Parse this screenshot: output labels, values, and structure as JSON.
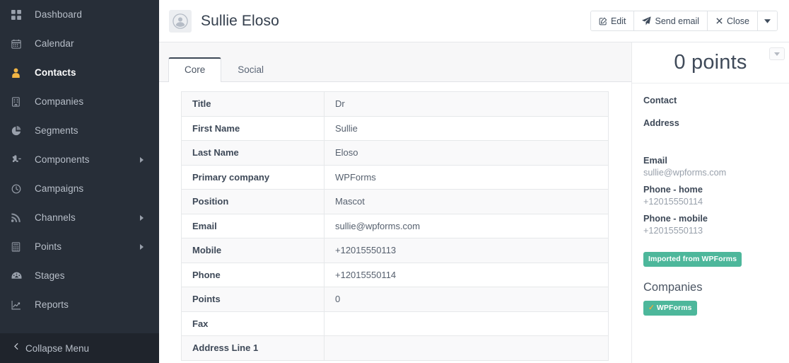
{
  "sidebar": {
    "items": [
      {
        "label": "Dashboard",
        "icon": "dashboard-icon",
        "active": false,
        "submenu": false
      },
      {
        "label": "Calendar",
        "icon": "calendar-icon",
        "active": false,
        "submenu": false
      },
      {
        "label": "Contacts",
        "icon": "contact-icon",
        "active": true,
        "submenu": false
      },
      {
        "label": "Companies",
        "icon": "building-icon",
        "active": false,
        "submenu": false
      },
      {
        "label": "Segments",
        "icon": "pie-chart-icon",
        "active": false,
        "submenu": false
      },
      {
        "label": "Components",
        "icon": "puzzle-icon",
        "active": false,
        "submenu": true
      },
      {
        "label": "Campaigns",
        "icon": "clock-icon",
        "active": false,
        "submenu": false
      },
      {
        "label": "Channels",
        "icon": "rss-icon",
        "active": false,
        "submenu": true
      },
      {
        "label": "Points",
        "icon": "calculator-icon",
        "active": false,
        "submenu": true
      },
      {
        "label": "Stages",
        "icon": "gauge-icon",
        "active": false,
        "submenu": false
      },
      {
        "label": "Reports",
        "icon": "chart-line-icon",
        "active": false,
        "submenu": false
      }
    ],
    "collapse": {
      "label": "Collapse Menu",
      "icon": "chevron-left-icon"
    },
    "colors": {
      "background": "#272e38",
      "active_icon": "#f2b544",
      "label": "#b8bfc9"
    }
  },
  "header": {
    "title": "Sullie Eloso",
    "avatar_icon": "user-avatar-icon",
    "buttons": [
      {
        "label": "Edit",
        "icon": "pencil-square-icon"
      },
      {
        "label": "Send email",
        "icon": "paper-plane-icon"
      },
      {
        "label": "Close",
        "icon": "times-icon"
      }
    ],
    "dropdown_icon": "caret-down-icon"
  },
  "tabs": [
    {
      "label": "Core",
      "active": true
    },
    {
      "label": "Social",
      "active": false
    }
  ],
  "core_table": {
    "rows": [
      {
        "key": "Title",
        "value": "Dr"
      },
      {
        "key": "First Name",
        "value": "Sullie"
      },
      {
        "key": "Last Name",
        "value": "Eloso"
      },
      {
        "key": "Primary company",
        "value": "WPForms"
      },
      {
        "key": "Position",
        "value": "Mascot"
      },
      {
        "key": "Email",
        "value": "sullie@wpforms.com"
      },
      {
        "key": "Mobile",
        "value": "+12015550113"
      },
      {
        "key": "Phone",
        "value": "+12015550114"
      },
      {
        "key": "Points",
        "value": "0"
      },
      {
        "key": "Fax",
        "value": ""
      },
      {
        "key": "Address Line 1",
        "value": ""
      }
    ]
  },
  "right_panel": {
    "points_label": "0 points",
    "dropdown_icon": "caret-down-icon",
    "contact_heading": "Contact",
    "address_heading": "Address",
    "details": [
      {
        "key": "Email",
        "value": "sullie@wpforms.com"
      },
      {
        "key": "Phone - home",
        "value": "+12015550114"
      },
      {
        "key": "Phone - mobile",
        "value": "+12015550113"
      }
    ],
    "import_badge": "Imported from WPForms",
    "companies_heading": "Companies",
    "company_badge": "WPForms",
    "company_badge_icon": "check-icon",
    "colors": {
      "badge_bg": "#4db79b",
      "check": "#f0a93a"
    }
  }
}
